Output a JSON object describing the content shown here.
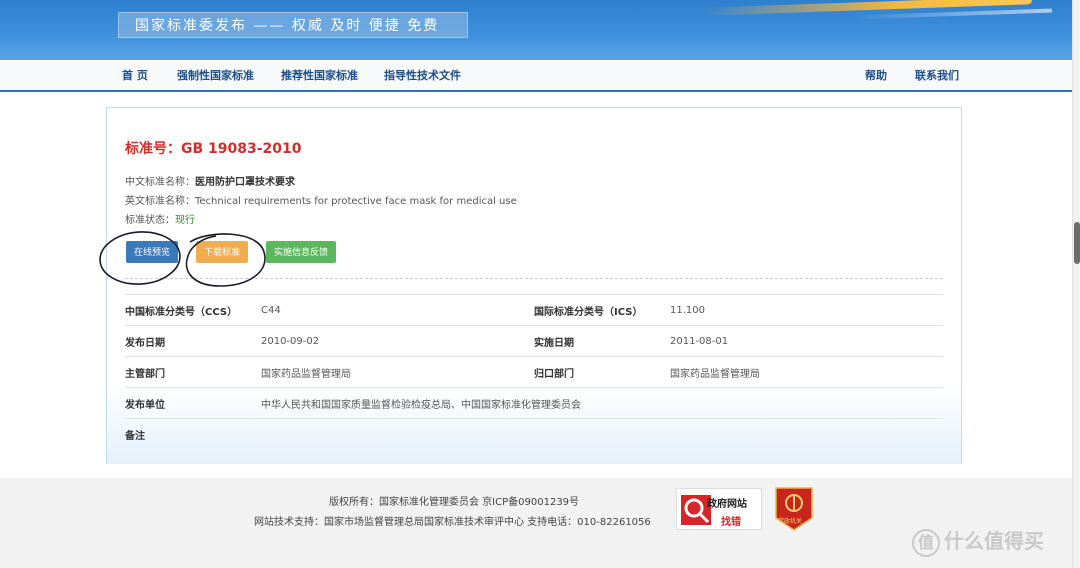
{
  "banner": {
    "slogan": "国家标准委发布 —— 权威 及时 便捷 免费"
  },
  "nav": {
    "items": [
      "首 页",
      "强制性国家标准",
      "推荐性国家标准",
      "指导性技术文件"
    ],
    "help": "帮助",
    "contact": "联系我们"
  },
  "standard": {
    "number_label": "标准号：GB 19083-2010",
    "cn_name_label": "中文标准名称：",
    "cn_name": "医用防护口罩技术要求",
    "en_name_label": "英文标准名称：",
    "en_name": "Technical requirements for protective face mask for medical use",
    "status_label": "标准状态：",
    "status": "现行"
  },
  "buttons": {
    "preview": "在线预览",
    "download": "下载标准",
    "feedback": "实施信息反馈"
  },
  "colors": {
    "preview": "#3a7ab8",
    "download": "#f0ad4e",
    "feedback": "#5cb85c",
    "title_red": "#d0302a"
  },
  "meta": [
    {
      "l1": "中国标准分类号（CCS）",
      "v1": "C44",
      "l2": "国际标准分类号（ICS）",
      "v2": "11.100"
    },
    {
      "l1": "发布日期",
      "v1": "2010-09-02",
      "l2": "实施日期",
      "v2": "2011-08-01"
    },
    {
      "l1": "主管部门",
      "v1": "国家药品监督管理局",
      "l2": "归口部门",
      "v2": "国家药品监督管理局"
    },
    {
      "l1": "发布单位",
      "v1": "中华人民共和国国家质量监督检验检疫总局、中国国家标准化管理委员会",
      "l2": "",
      "v2": ""
    },
    {
      "l1": "备注",
      "v1": "",
      "l2": "",
      "v2": ""
    }
  ],
  "footer": {
    "copyright": "版权所有：国家标准化管理委员会 京ICP备09001239号",
    "support": "网站技术支持：国家市场监督管理总局国家标准技术审评中心 支持电话：010-82261056",
    "badge_title": "政府网站",
    "badge_sub": "找错",
    "party_label": "党政机关"
  },
  "watermark": {
    "text": "什么值得买",
    "icon": "值"
  }
}
